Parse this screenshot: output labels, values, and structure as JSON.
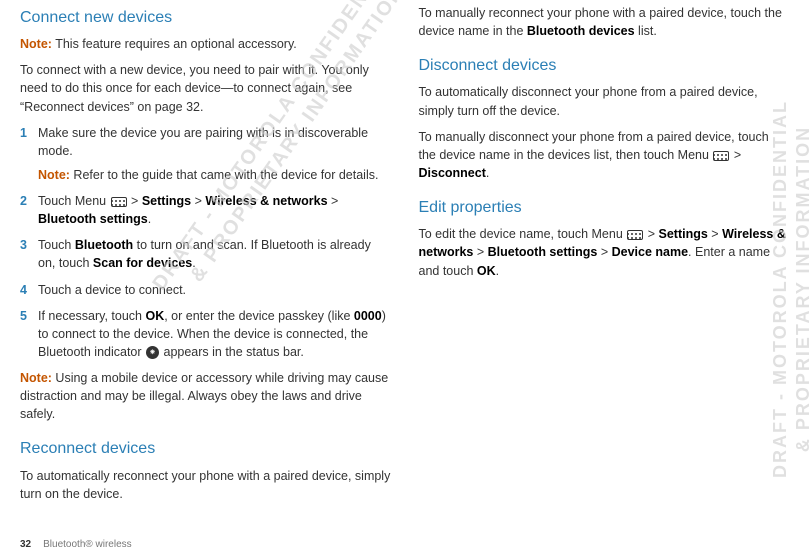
{
  "left": {
    "h1": "Connect new devices",
    "noteLabel": "Note:",
    "note1": " This feature requires an optional accessory.",
    "intro": "To connect with a new device, you need to pair with it. You only need to do this once for each device—to connect again, see “Reconnect devices” on page 32.",
    "s1n": "1",
    "s1a": "Make sure the device you are pairing with is in discoverable mode.",
    "s1nb": " Refer to the guide that came with the device for details.",
    "s2n": "2",
    "s2a": "Touch Menu ",
    "s2b": " > ",
    "s2c": "Settings",
    "s2d": " > ",
    "s2e": "Wireless & networks",
    "s2f": " > ",
    "s2g": "Bluetooth settings",
    "s2h": ".",
    "s3n": "3",
    "s3a": "Touch ",
    "s3b": "Bluetooth",
    "s3c": " to turn on and scan. If Bluetooth is already on, touch ",
    "s3d": "Scan for devices",
    "s3e": ".",
    "s4n": "4",
    "s4a": "Touch a device to connect.",
    "s5n": "5",
    "s5a": "If necessary, touch ",
    "s5b": "OK",
    "s5c": ", or enter the device passkey (like ",
    "s5d": "0000",
    "s5e": ") to connect to the device. When the device is connected, the Bluetooth indicator ",
    "s5f": " appears in the status bar.",
    "note2": " Using a mobile device or accessory while driving may cause distraction and may be illegal. Always obey the laws and drive safely.",
    "h2": "Reconnect devices",
    "rec1": "To automatically reconnect your phone with a paired device, simply turn on the device."
  },
  "right": {
    "p1a": "To manually reconnect your phone with a paired device, touch the device name in the ",
    "p1b": "Bluetooth devices",
    "p1c": " list.",
    "h1": "Disconnect devices",
    "d1": "To automatically disconnect your phone from a paired device, simply turn off the device.",
    "d2a": "To manually disconnect your phone from a paired device, touch the device name in the devices list, then touch Menu ",
    "d2b": " > ",
    "d2c": "Disconnect",
    "d2d": ".",
    "h2": "Edit properties",
    "e1a": "To edit the device name, touch Menu ",
    "e1b": " > ",
    "e1c": "Settings",
    "e1d": " > ",
    "e1e": "Wireless & networks",
    "e1f": " > ",
    "e1g": "Bluetooth settings",
    "e1h": " > ",
    "e1i": "Device name",
    "e1j": ". Enter a name and touch ",
    "e1k": "OK",
    "e1l": "."
  },
  "footer": {
    "page": "32",
    "section": "Bluetooth® wireless"
  },
  "wm1": "DRAFT - MOTOROLA CONFIDENTIAL\n& PROPRIETARY INFORMATION",
  "wm2": "DRAFT - MOTOROLA CONFIDENTIAL\n& PROPRIETARY INFORMATION"
}
